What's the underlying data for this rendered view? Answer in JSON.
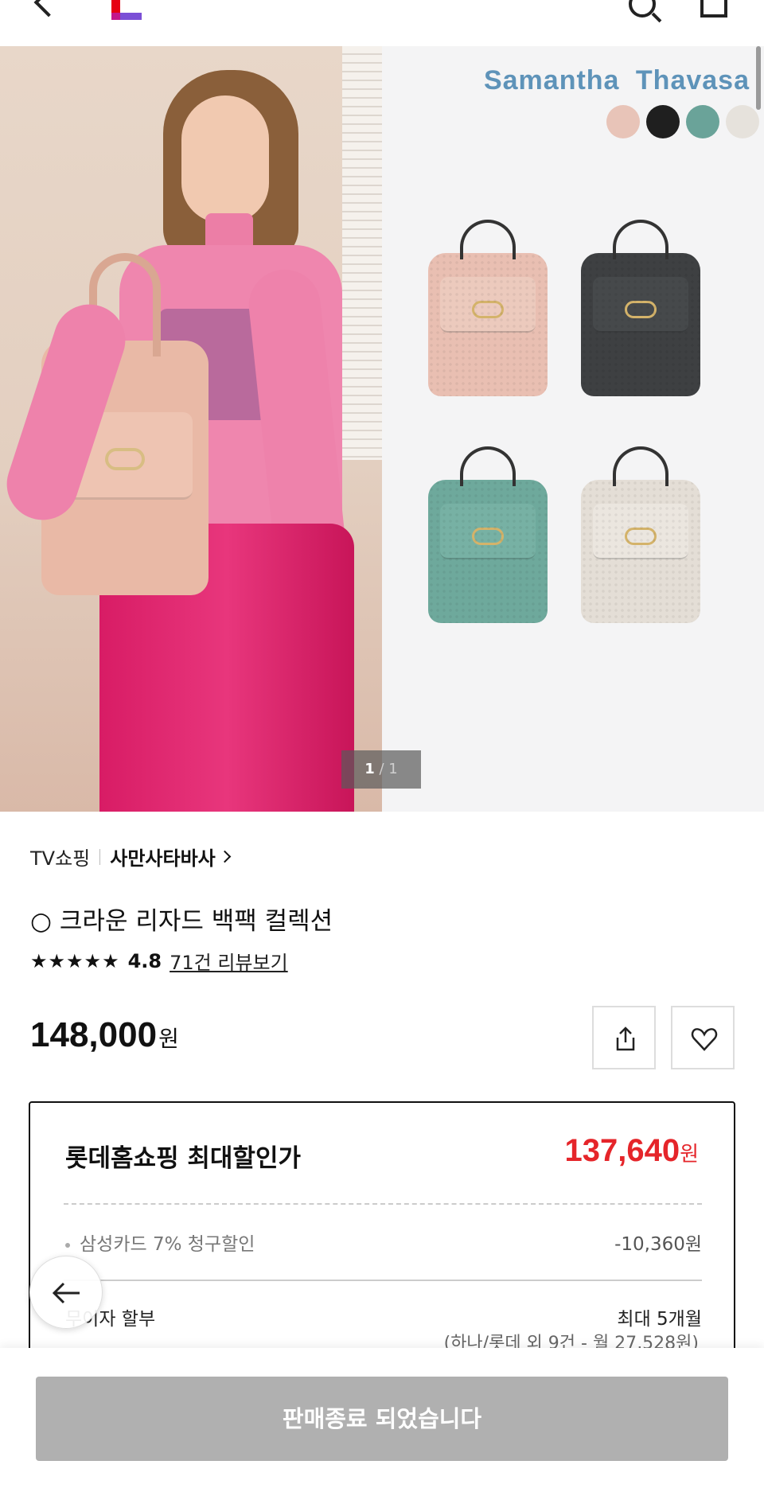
{
  "header": {
    "back_icon": "chevron-left-icon",
    "logo_icon": "lotte-logo-icon",
    "search_icon": "search-icon",
    "cart_icon": "cart-icon"
  },
  "hero": {
    "brand_text": "Samantha Thavasa",
    "swatches": [
      "#e8c4b8",
      "#1f1f1f",
      "#6aa399",
      "#e6e2dc"
    ],
    "counter_current": "1",
    "counter_total": " / 1",
    "bag_colors": [
      "#e9bfb2",
      "#3e4042",
      "#6ea99c",
      "#e4ded6"
    ]
  },
  "product": {
    "channel": "TV쇼핑",
    "brand": "사만사타바사",
    "title": "○ 크라운 리자드 백팩 컬렉션",
    "stars": "★★★★★",
    "score": "4.8",
    "reviews": "71건 리뷰보기",
    "price": "148,000",
    "currency": "원"
  },
  "actions": {
    "share_icon": "share-icon",
    "wish_icon": "heart-icon"
  },
  "discount": {
    "title": "롯데홈쇼핑 최대할인가",
    "price": "137,640",
    "currency": "원",
    "card_label": "삼성카드 7% 청구할인",
    "card_amount": "-10,360원",
    "installment_label": "무이자 할부",
    "installment_value": "최대 5개월",
    "installment_detail": "(하나/롯데 외 9건 - 월 27,528원)"
  },
  "bottom": {
    "soldout_label": "판매종료 되었습니다",
    "float_back_icon": "arrow-left-icon"
  }
}
